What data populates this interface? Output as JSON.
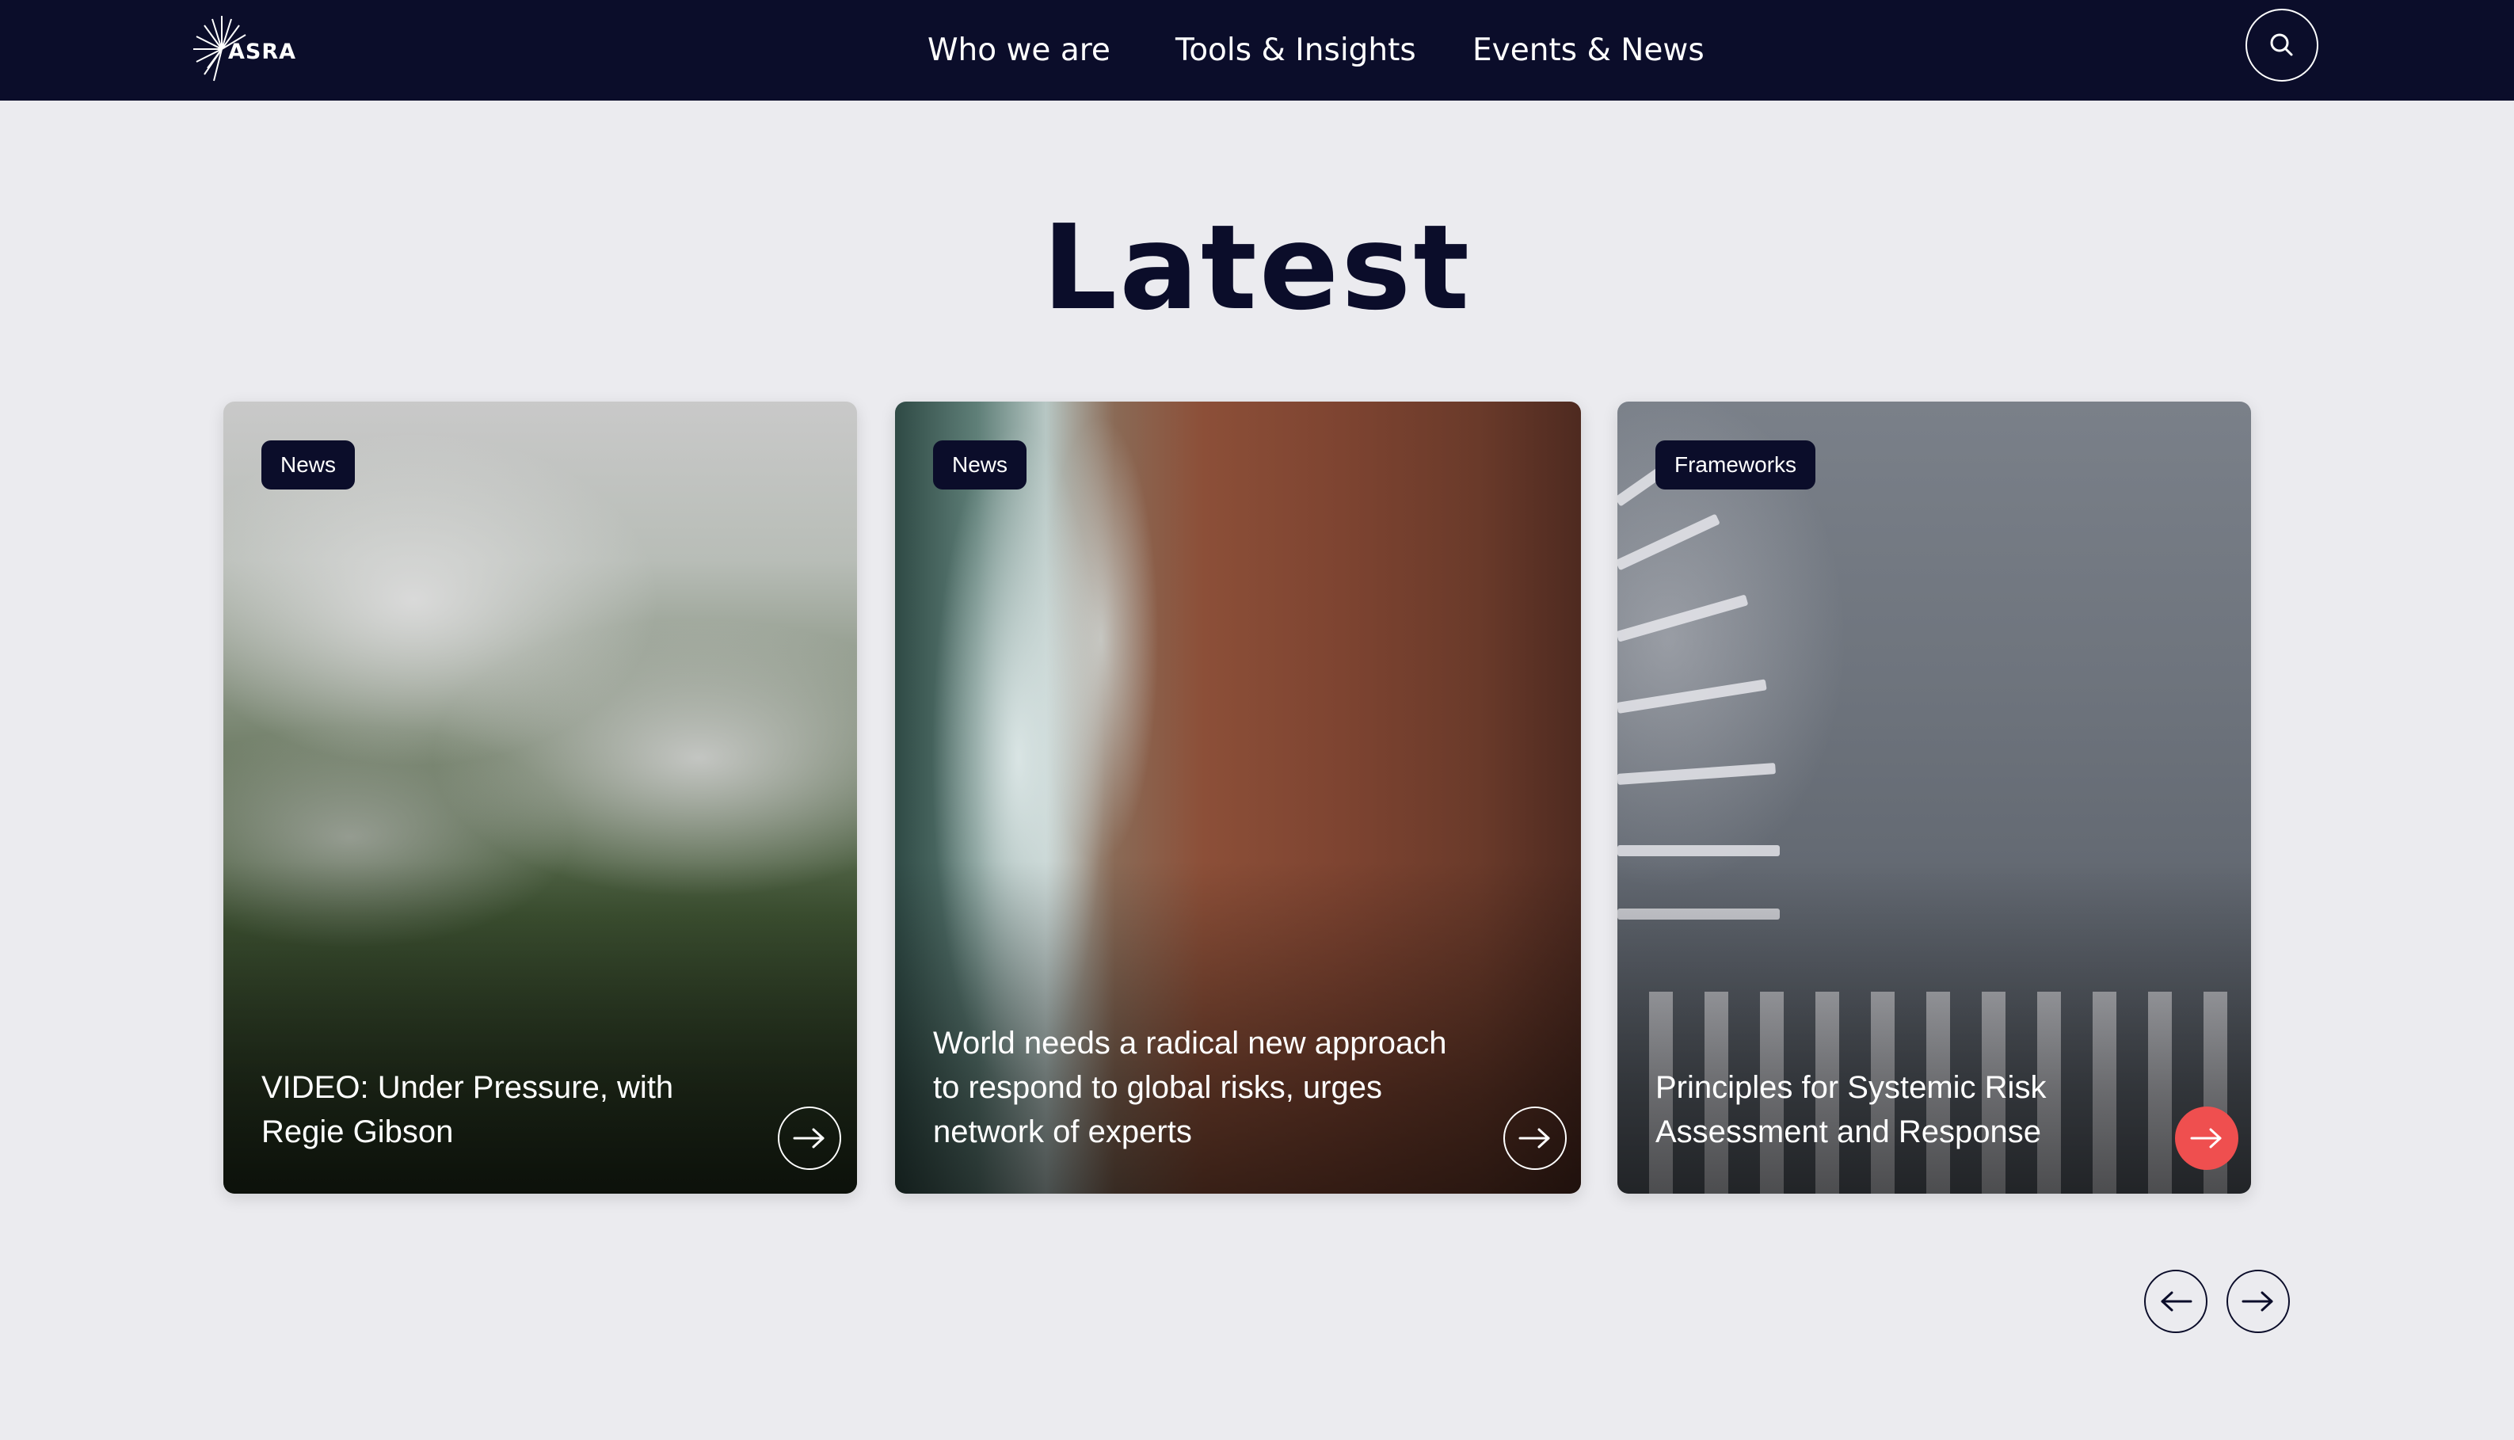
{
  "header": {
    "logo_text": "ASRA",
    "nav": [
      {
        "label": "Who we are"
      },
      {
        "label": "Tools & Insights"
      },
      {
        "label": "Events & News"
      }
    ],
    "search_icon": "search-icon"
  },
  "main": {
    "heading": "Latest",
    "cards": [
      {
        "tag": "News",
        "title": "VIDEO: Under Pressure, with Regie Gibson",
        "image": "misty-forest",
        "arrow_icon": "arrow-right-icon"
      },
      {
        "tag": "News",
        "title": "World needs a radical new approach to respond to global risks, urges network of experts",
        "image": "aerial-beach-waves",
        "arrow_icon": "arrow-right-icon"
      },
      {
        "tag": "Frameworks",
        "title": "Principles for Systemic Risk Assessment and Response",
        "image": "aerial-crosswalk-pedestrians",
        "arrow_icon": "arrow-right-icon",
        "arrow_color": "#ef4f4f"
      }
    ],
    "carousel": {
      "prev_icon": "arrow-left-icon",
      "next_icon": "arrow-right-icon"
    }
  },
  "colors": {
    "navy": "#0b0d2a",
    "background": "#ebebef",
    "accent": "#ef4f4f"
  }
}
